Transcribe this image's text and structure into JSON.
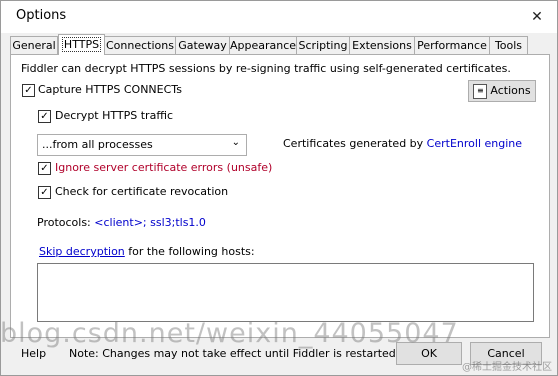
{
  "window": {
    "title": "Options",
    "close_glyph": "✕"
  },
  "tabs": [
    {
      "label": "General"
    },
    {
      "label": "HTTPS"
    },
    {
      "label": "Connections"
    },
    {
      "label": "Gateway"
    },
    {
      "label": "Appearance"
    },
    {
      "label": "Scripting"
    },
    {
      "label": "Extensions"
    },
    {
      "label": "Performance"
    },
    {
      "label": "Tools"
    }
  ],
  "https": {
    "description": "Fiddler can decrypt HTTPS sessions by re-signing traffic using self-generated certificates.",
    "capture_label": "Capture HTTPS CONNECTs",
    "capture_checked": true,
    "actions_label": "Actions",
    "decrypt_label": "Decrypt HTTPS traffic",
    "decrypt_checked": true,
    "process_filter_value": "...from all processes",
    "certificates_prefix": "Certificates generated by ",
    "certificates_engine": "CertEnroll engine",
    "ignore_errors_label": "Ignore server certificate errors (unsafe)",
    "ignore_errors_checked": true,
    "revocation_label": "Check for certificate revocation",
    "revocation_checked": true,
    "protocols_label": "Protocols: ",
    "protocols_value": "<client>; ssl3;tls1.0",
    "skip_decryption_link": "Skip decryption",
    "skip_decryption_suffix": " for the following hosts:",
    "hosts_value": ""
  },
  "footer": {
    "help_label": "Help",
    "note": "Note: Changes may not take effect until Fiddler is restarted.",
    "ok_label": "OK",
    "cancel_label": "Cancel"
  },
  "overlay": {
    "watermark": "blog.csdn.net/weixin_44055047",
    "corner_mark": "@稀土掘金技术社区"
  },
  "colors": {
    "link": "#0000cc",
    "warning_text": "#b0002a",
    "accent_check": "#333333"
  }
}
